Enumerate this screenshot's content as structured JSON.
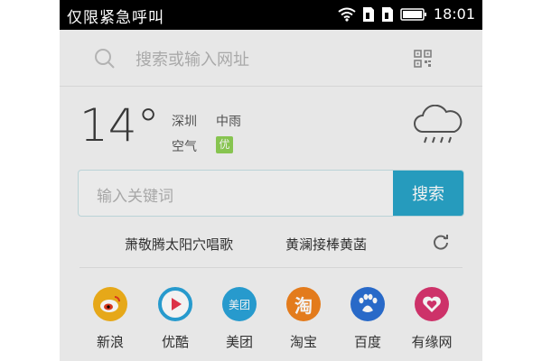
{
  "status_bar": {
    "text": "仅限紧急呼叫",
    "time": "18:01",
    "icons": [
      "wifi-icon",
      "sim1-icon",
      "sim2-icon",
      "battery-icon"
    ]
  },
  "search": {
    "placeholder": "搜索或输入网址",
    "icons": [
      "search-icon",
      "qr-code-icon"
    ]
  },
  "weather": {
    "temperature": "14°",
    "city": "深圳",
    "condition": "中雨",
    "aqi_label": "空气",
    "aqi_value": "优",
    "icon": "rain-cloud-icon"
  },
  "keyword_search": {
    "placeholder": "输入关键词",
    "button": "搜索"
  },
  "hot_searches": {
    "items": [
      "萧敬腾太阳穴唱歌",
      "黄澜接棒黄菡"
    ],
    "refresh_icon": "refresh-icon"
  },
  "apps": [
    {
      "label": "新浪",
      "icon": "weibo-icon",
      "color": "#f3b21b"
    },
    {
      "label": "优酷",
      "icon": "youku-icon",
      "color": "#2aa3d9"
    },
    {
      "label": "美团",
      "icon": "meituan-icon",
      "icon_text": "美团",
      "color": "#2aa3d9"
    },
    {
      "label": "淘宝",
      "icon": "taobao-icon",
      "icon_text": "淘",
      "color": "#f0821e"
    },
    {
      "label": "百度",
      "icon": "baidu-icon",
      "color": "#2b6fd3"
    },
    {
      "label": "有缘网",
      "icon": "youyuan-icon",
      "color": "#d8356f"
    }
  ]
}
